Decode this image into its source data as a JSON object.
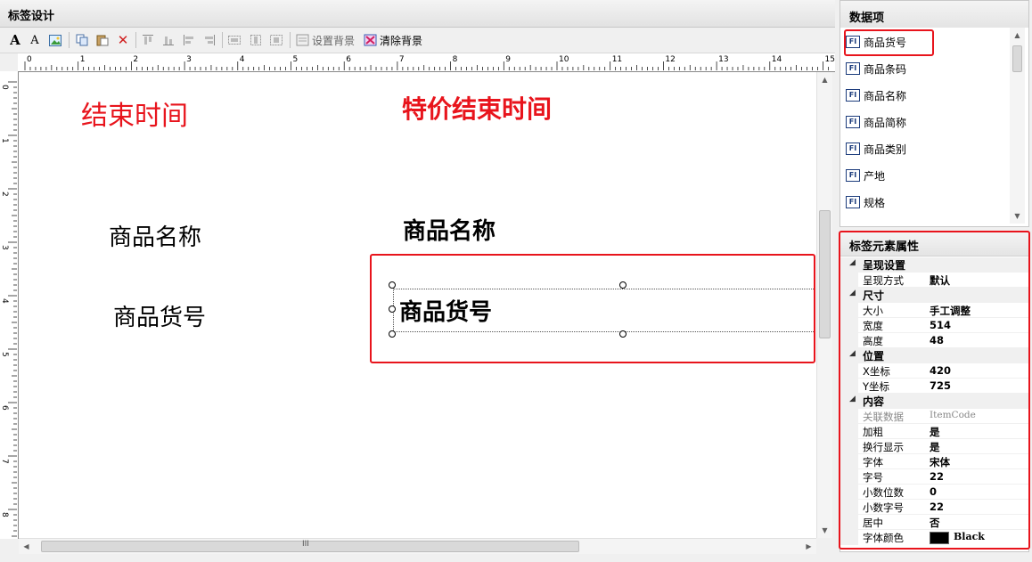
{
  "designer": {
    "title": "标签设计",
    "toolbar": {
      "set_bg_label": "设置背景",
      "clear_bg_label": "清除背景"
    },
    "ruler": {
      "h_marks": [
        "0",
        "1",
        "2",
        "3",
        "4",
        "5",
        "6",
        "7",
        "8",
        "9",
        "10",
        "11",
        "12",
        "13",
        "14",
        "15"
      ],
      "v_marks": [
        "0",
        "1",
        "2",
        "3",
        "4",
        "5",
        "6",
        "7",
        "8"
      ]
    },
    "canvas": {
      "labels": {
        "end_time": "结束时间",
        "special_end_time": "特价结束时间",
        "name_left": "商品名称",
        "name_right": "商品名称",
        "code_left": "商品货号",
        "code_selected": "商品货号"
      }
    },
    "hscroll_grip": "III"
  },
  "data_panel": {
    "title": "数据项",
    "icon_text": "FI",
    "items": [
      "商品货号",
      "商品条码",
      "商品名称",
      "商品简称",
      "商品类别",
      "产地",
      "规格"
    ]
  },
  "props": {
    "title": "标签元素属性",
    "groups": {
      "render": "呈现设置",
      "size": "尺寸",
      "position": "位置",
      "content": "内容"
    },
    "rows": {
      "render_mode": {
        "k": "呈现方式",
        "v": "默认"
      },
      "size_mode": {
        "k": "大小",
        "v": "手工调整"
      },
      "width": {
        "k": "宽度",
        "v": "514"
      },
      "height": {
        "k": "高度",
        "v": "48"
      },
      "x": {
        "k": "X坐标",
        "v": "420"
      },
      "y": {
        "k": "Y坐标",
        "v": "725"
      },
      "binding": {
        "k": "关联数据",
        "v": "ItemCode"
      },
      "bold": {
        "k": "加粗",
        "v": "是"
      },
      "wrap": {
        "k": "换行显示",
        "v": "是"
      },
      "font": {
        "k": "字体",
        "v": "宋体"
      },
      "font_size": {
        "k": "字号",
        "v": "22"
      },
      "decimals": {
        "k": "小数位数",
        "v": "0"
      },
      "decimal_font_size": {
        "k": "小数字号",
        "v": "22"
      },
      "center": {
        "k": "居中",
        "v": "否"
      },
      "font_color": {
        "k": "字体颜色",
        "v": "Black"
      }
    }
  },
  "colors": {
    "highlight": "#e8141c",
    "font_color_swatch": "#000000"
  }
}
